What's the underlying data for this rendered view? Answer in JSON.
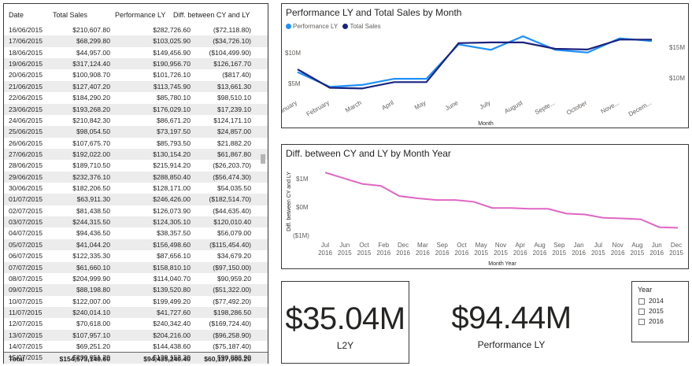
{
  "table": {
    "headers": {
      "date": "Date",
      "total_sales": "Total Sales",
      "performance_ly": "Performance LY",
      "diff": "Diff. between CY and LY"
    },
    "rows": [
      [
        "16/06/2015",
        "$210,607.80",
        "$282,726.60",
        "($72,118.80)"
      ],
      [
        "17/06/2015",
        "$68,299.80",
        "$103,025.90",
        "($34,726.10)"
      ],
      [
        "18/06/2015",
        "$44,957.00",
        "$149,456.90",
        "($104,499.90)"
      ],
      [
        "19/06/2015",
        "$317,124.40",
        "$190,956.70",
        "$126,167.70"
      ],
      [
        "20/06/2015",
        "$100,908.70",
        "$101,726.10",
        "($817.40)"
      ],
      [
        "21/06/2015",
        "$127,407.20",
        "$113,745.90",
        "$13,661.30"
      ],
      [
        "22/06/2015",
        "$184,290.20",
        "$85,780.10",
        "$98,510.10"
      ],
      [
        "23/06/2015",
        "$193,268.20",
        "$176,029.10",
        "$17,239.10"
      ],
      [
        "24/06/2015",
        "$210,842.30",
        "$86,671.20",
        "$124,171.10"
      ],
      [
        "25/06/2015",
        "$98,054.50",
        "$73,197.50",
        "$24,857.00"
      ],
      [
        "26/06/2015",
        "$107,675.70",
        "$85,793.50",
        "$21,882.20"
      ],
      [
        "27/06/2015",
        "$192,022.00",
        "$130,154.20",
        "$61,867.80"
      ],
      [
        "28/06/2015",
        "$189,710.50",
        "$215,914.20",
        "($26,203.70)"
      ],
      [
        "29/06/2015",
        "$232,376.10",
        "$288,850.40",
        "($56,474.30)"
      ],
      [
        "30/06/2015",
        "$182,206.50",
        "$128,171.00",
        "$54,035.50"
      ],
      [
        "01/07/2015",
        "$63,911.30",
        "$246,426.00",
        "($182,514.70)"
      ],
      [
        "02/07/2015",
        "$81,438.50",
        "$126,073.90",
        "($44,635.40)"
      ],
      [
        "03/07/2015",
        "$244,315.50",
        "$124,305.10",
        "$120,010.40"
      ],
      [
        "04/07/2015",
        "$94,436.50",
        "$38,357.50",
        "$56,079.00"
      ],
      [
        "05/07/2015",
        "$41,044.20",
        "$156,498.60",
        "($115,454.40)"
      ],
      [
        "06/07/2015",
        "$122,335.30",
        "$87,656.10",
        "$34,679.20"
      ],
      [
        "07/07/2015",
        "$61,660.10",
        "$158,810.10",
        "($97,150.00)"
      ],
      [
        "08/07/2015",
        "$204,999.90",
        "$114,040.70",
        "$90,959.20"
      ],
      [
        "09/07/2015",
        "$88,198.80",
        "$139,520.80",
        "($51,322.00)"
      ],
      [
        "10/07/2015",
        "$122,007.00",
        "$199,499.20",
        "($77,492.20)"
      ],
      [
        "11/07/2015",
        "$240,014.10",
        "$41,727.60",
        "$198,286.50"
      ],
      [
        "12/07/2015",
        "$70,618.00",
        "$240,342.40",
        "($169,724.40)"
      ],
      [
        "13/07/2015",
        "$107,957.10",
        "$204,216.00",
        "($96,258.90)"
      ],
      [
        "14/07/2015",
        "$69,251.20",
        "$144,438.60",
        "($75,187.40)"
      ],
      [
        "15/07/2015",
        "$230,051.20",
        "$139,152.30",
        "$90,898.90"
      ]
    ],
    "totals": {
      "label": "Total",
      "total_sales": "$154,573,140.60",
      "performance_ly": "$94,435,240.40",
      "diff": "$60,137,900.20"
    }
  },
  "chart1": {
    "title": "Performance LY and Total Sales by Month",
    "legend": [
      "Performance LY",
      "Total Sales"
    ],
    "colors": {
      "performance_ly": "#1e90ff",
      "total_sales": "#1a237e"
    },
    "left_ticks": [
      "$10M",
      "$5M"
    ],
    "right_ticks": [
      "$15M",
      "$10M"
    ]
  },
  "chart2": {
    "title": "Diff. between CY and LY by Month Year",
    "color": "#e066c3",
    "y_ticks": [
      "$1M",
      "$0M",
      "($1M)"
    ]
  },
  "chart_data": [
    {
      "type": "line",
      "title": "Performance LY and Total Sales by Month",
      "xlabel": "Month",
      "categories": [
        "January",
        "February",
        "March",
        "April",
        "May",
        "June",
        "July",
        "August",
        "Septe...",
        "October",
        "Nove...",
        "Decem..."
      ],
      "series": [
        {
          "name": "Performance LY",
          "axis": "left",
          "values": [
            5.9,
            3.7,
            4.0,
            4.9,
            4.9,
            10.0,
            9.2,
            11.2,
            9.2,
            8.8,
            10.9,
            10.5
          ]
        },
        {
          "name": "Total Sales",
          "axis": "right",
          "values": [
            11.6,
            9.0,
            8.9,
            9.8,
            9.8,
            15.3,
            15.4,
            15.4,
            14.5,
            14.4,
            15.8,
            15.8
          ]
        }
      ],
      "left_ylim": [
        2.0,
        12.5
      ],
      "right_ylim": [
        7.5,
        17.5
      ]
    },
    {
      "type": "line",
      "title": "Diff. between CY and LY by Month Year",
      "xlabel": "Month Year",
      "ylabel": "Diff. between CY and LY",
      "categories": [
        "Jul 2016",
        "Jun 2015",
        "Oct 2015",
        "Feb 2016",
        "Dec 2016",
        "Mar 2016",
        "Sep 2016",
        "Oct 2016",
        "May 2015",
        "Nov 2015",
        "Apr 2016",
        "Aug 2016",
        "Sep 2015",
        "Jan 2016",
        "Jul 2015",
        "Nov 2016",
        "Aug 2015",
        "Jun 2016",
        "Dec 2015"
      ],
      "series": [
        {
          "name": "Diff. between CY and LY",
          "values": [
            1.15,
            0.95,
            0.75,
            0.68,
            0.32,
            0.24,
            0.18,
            0.18,
            0.12,
            -0.1,
            -0.1,
            -0.13,
            -0.13,
            -0.3,
            -0.33,
            -0.45,
            -0.47,
            -0.5,
            -0.78,
            -0.8
          ]
        }
      ],
      "ylim": [
        -1.15,
        1.35
      ]
    }
  ],
  "card_l2y": {
    "value": "$35.04M",
    "label": "L2Y"
  },
  "card_ply": {
    "value": "$94.44M",
    "label": "Performance LY"
  },
  "slicer": {
    "title": "Year",
    "options": [
      "2014",
      "2015",
      "2016"
    ]
  }
}
